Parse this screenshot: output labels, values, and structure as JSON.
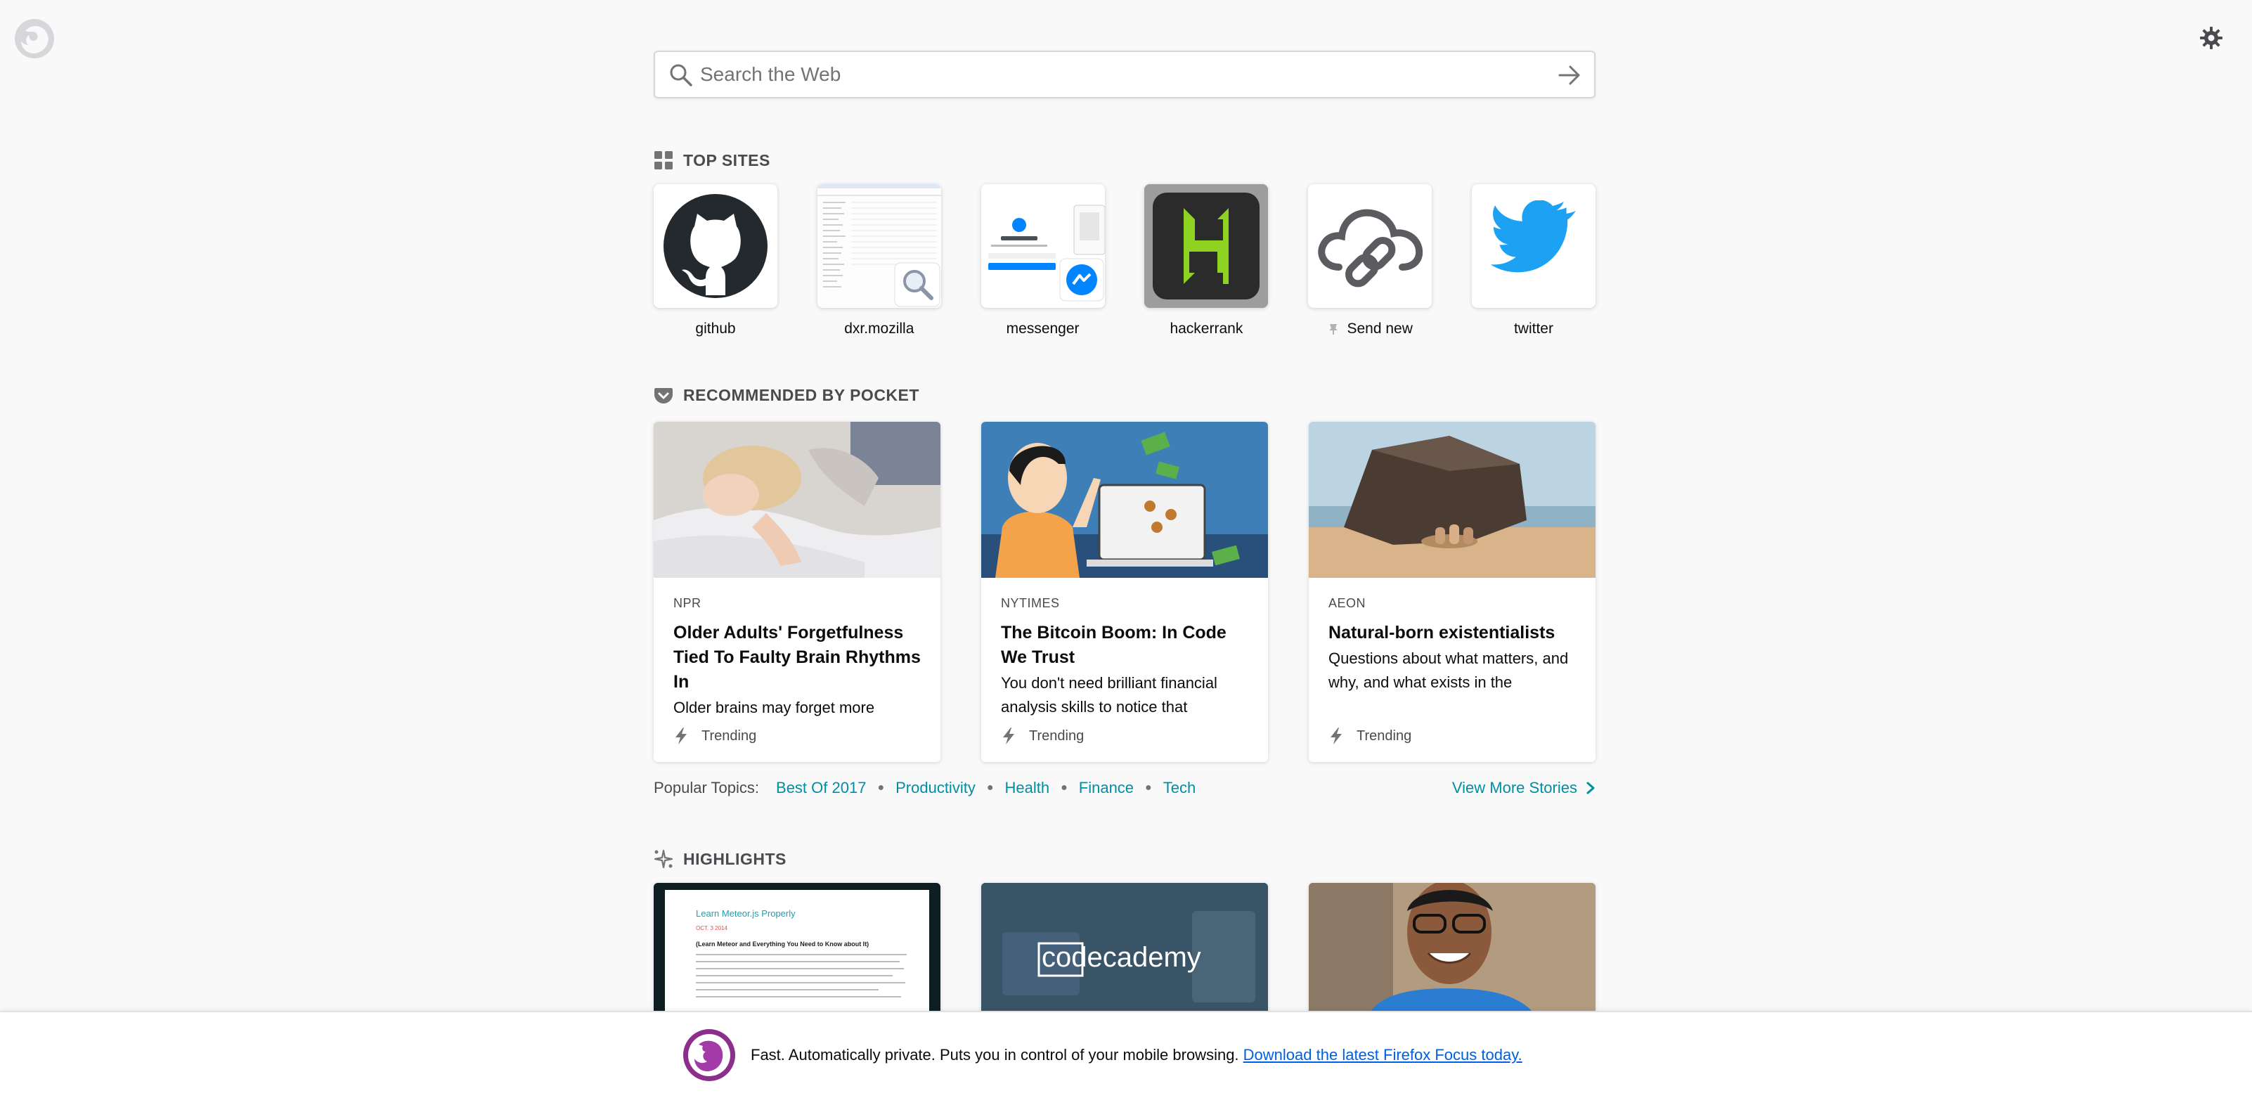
{
  "search": {
    "placeholder": "Search the Web"
  },
  "top_sites": {
    "title": "TOP SITES",
    "items": [
      {
        "label": "github"
      },
      {
        "label": "dxr.mozilla"
      },
      {
        "label": "messenger"
      },
      {
        "label": "hackerrank"
      },
      {
        "label": "Send new",
        "pinned": true
      },
      {
        "label": "twitter"
      }
    ]
  },
  "pocket": {
    "title": "RECOMMENDED BY POCKET",
    "cards": [
      {
        "source": "NPR",
        "title": "Older Adults' Forgetfulness Tied To Faulty Brain Rhythms In",
        "excerpt": "Older brains may forget more",
        "context": "Trending"
      },
      {
        "source": "NYTIMES",
        "title": "The Bitcoin Boom: In Code We Trust",
        "excerpt": "You don't need brilliant financial analysis skills to notice that",
        "context": "Trending"
      },
      {
        "source": "AEON",
        "title": "Natural-born existentialists",
        "excerpt": "Questions about what matters, and why, and what exists in the",
        "context": "Trending"
      }
    ],
    "popular_label": "Popular Topics:",
    "topics": [
      "Best Of 2017",
      "Productivity",
      "Health",
      "Finance",
      "Tech"
    ],
    "more_label": "View More Stories"
  },
  "highlights": {
    "title": "HIGHLIGHTS",
    "card1": {
      "heading": "Learn Meteor.js Properly",
      "date": "OCT. 3 2014",
      "subheading": "(Learn Meteor and Everything You Need to Know about It)"
    },
    "card2": {
      "logo_left": "code",
      "logo_right": "cademy"
    }
  },
  "snippet": {
    "text": "Fast. Automatically private. Puts you in control of your mobile browsing.",
    "link": "Download the latest Firefox Focus today."
  },
  "colors": {
    "accent_link": "#008ea4",
    "snippet_link": "#0060df",
    "twitter_blue": "#1da1f2",
    "hackerrank_green": "#8ed321"
  }
}
